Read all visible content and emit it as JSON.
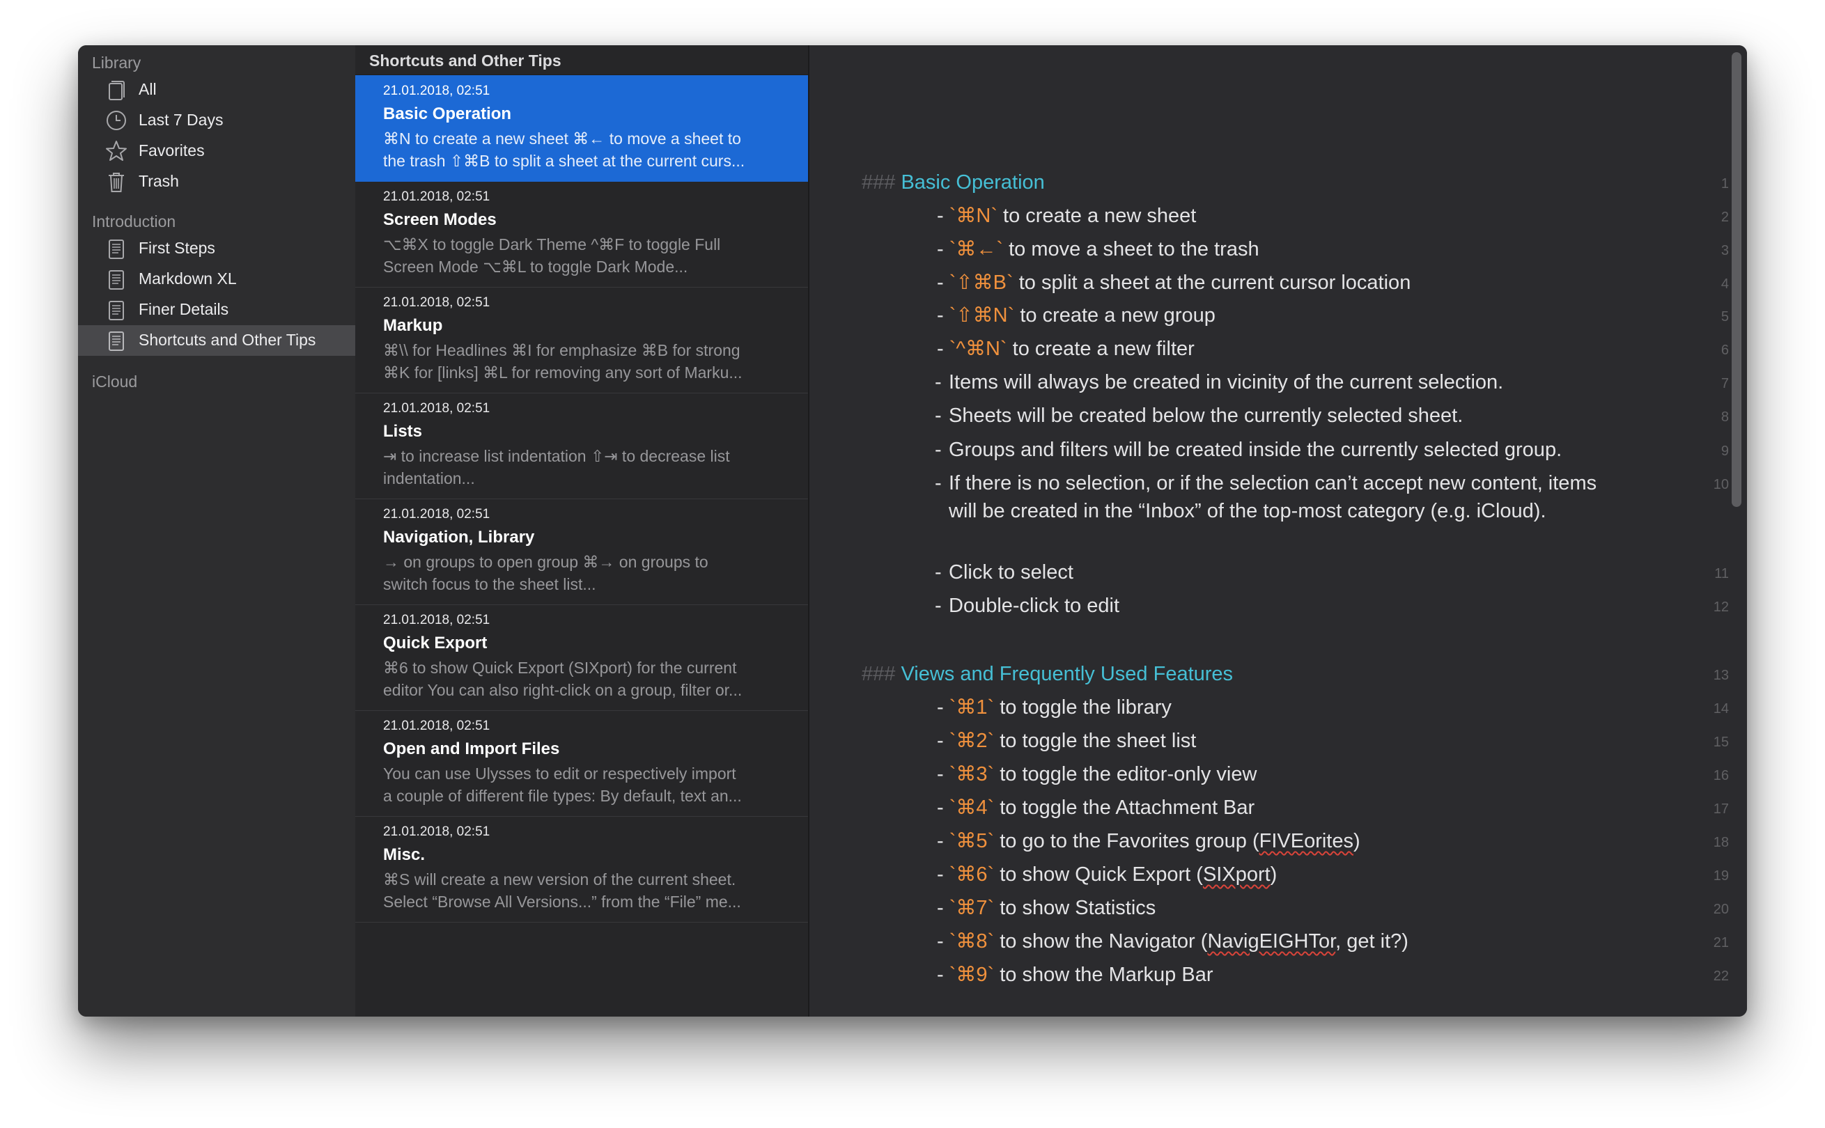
{
  "library": {
    "library_header": "Library",
    "library_items": [
      {
        "label": "All",
        "icon": "all-sheets-icon"
      },
      {
        "label": "Last 7 Days",
        "icon": "clock-icon"
      },
      {
        "label": "Favorites",
        "icon": "star-icon"
      },
      {
        "label": "Trash",
        "icon": "trash-icon"
      }
    ],
    "introduction_header": "Introduction",
    "introduction_items": [
      {
        "label": "First Steps",
        "icon": "document-icon"
      },
      {
        "label": "Markdown XL",
        "icon": "document-icon"
      },
      {
        "label": "Finer Details",
        "icon": "document-icon"
      },
      {
        "label": "Shortcuts and Other Tips",
        "icon": "document-icon",
        "selected": true
      }
    ],
    "icloud_header": "iCloud"
  },
  "sheet_list": {
    "title": "Shortcuts and Other Tips",
    "sheets": [
      {
        "date": "21.01.2018, 02:51",
        "title": "Basic Operation",
        "excerpt": "⌘N to create a new sheet ⌘← to move a sheet to\nthe trash ⇧⌘B to split a sheet at the current curs...",
        "selected": true
      },
      {
        "date": "21.01.2018, 02:51",
        "title": "Screen Modes",
        "excerpt": "⌥⌘X to toggle Dark Theme ^⌘F to toggle Full\nScreen Mode ⌥⌘L to toggle Dark Mode..."
      },
      {
        "date": "21.01.2018, 02:51",
        "title": "Markup",
        "excerpt": "⌘\\\\ for Headlines ⌘I for emphasize ⌘B for strong\n⌘K for [links] ⌘L for removing any sort of Marku..."
      },
      {
        "date": "21.01.2018, 02:51",
        "title": "Lists",
        "excerpt": "⇥ to increase list indentation ⇧⇥ to decrease list\nindentation..."
      },
      {
        "date": "21.01.2018, 02:51",
        "title": "Navigation, Library",
        "excerpt": "→ on groups to open group ⌘→ on groups to\nswitch focus to the sheet list..."
      },
      {
        "date": "21.01.2018, 02:51",
        "title": "Quick Export",
        "excerpt": "⌘6 to show Quick Export (SIXport) for the current\neditor You can also right-click on a group, filter or..."
      },
      {
        "date": "21.01.2018, 02:51",
        "title": "Open and Import Files",
        "excerpt": "You can use Ulysses to edit or respectively import\na couple of different file types: By default, text an..."
      },
      {
        "date": "21.01.2018, 02:51",
        "title": "Misc.",
        "excerpt": "⌘S will create a new version of the current sheet.\nSelect “Browse All Versions...” from the “File” me..."
      }
    ]
  },
  "editor": {
    "lines": [
      {
        "num": "1",
        "kind": "heading",
        "hashes": "###",
        "text": "Basic Operation"
      },
      {
        "num": "2",
        "kind": "shortcut",
        "code": "`⌘N`",
        "text": "to create a new sheet"
      },
      {
        "num": "3",
        "kind": "shortcut",
        "code": "`⌘←`",
        "text": "to move a sheet to the trash"
      },
      {
        "num": "4",
        "kind": "shortcut",
        "code": "`⇧⌘B`",
        "text": "to split a sheet at the current cursor location"
      },
      {
        "num": "5",
        "kind": "shortcut",
        "code": "`⇧⌘N`",
        "text": "to create a new group"
      },
      {
        "num": "6",
        "kind": "shortcut",
        "code": "`^⌘N`",
        "text": "to create a new filter"
      },
      {
        "num": "7",
        "kind": "bullet",
        "text": "Items will always be created in vicinity of the current selection."
      },
      {
        "num": "8",
        "kind": "bullet",
        "text": "Sheets will be created below the currently selected sheet."
      },
      {
        "num": "9",
        "kind": "bullet",
        "text": "Groups and filters will be created inside the currently selected group."
      },
      {
        "num": "10",
        "kind": "bullet",
        "text": "If there is no selection, or if the selection can’t accept new content, items will be created in the “Inbox” of the top-most category (e.g. iCloud)."
      },
      {
        "num": "11",
        "kind": "bullet",
        "text": "Click to select"
      },
      {
        "num": "12",
        "kind": "bullet",
        "text": "Double-click to edit"
      },
      {
        "num": "13",
        "kind": "heading",
        "hashes": "###",
        "text": "Views and Frequently Used Features"
      },
      {
        "num": "14",
        "kind": "shortcut",
        "code": "`⌘1`",
        "text": "to toggle the library"
      },
      {
        "num": "15",
        "kind": "shortcut",
        "code": "`⌘2`",
        "text": "to toggle the sheet list"
      },
      {
        "num": "16",
        "kind": "shortcut",
        "code": "`⌘3`",
        "text": "to toggle the editor-only view"
      },
      {
        "num": "17",
        "kind": "shortcut",
        "code": "`⌘4`",
        "text": "to toggle the Attachment Bar"
      },
      {
        "num": "18",
        "kind": "shortcut",
        "code": "`⌘5`",
        "text": "to go to the Favorites group (",
        "spell": "FIVEorites",
        "after": ")"
      },
      {
        "num": "19",
        "kind": "shortcut",
        "code": "`⌘6`",
        "text": "to show Quick Export (",
        "spell": "SIXport",
        "after": ")"
      },
      {
        "num": "20",
        "kind": "shortcut",
        "code": "`⌘7`",
        "text": "to show Statistics"
      },
      {
        "num": "21",
        "kind": "shortcut",
        "code": "`⌘8`",
        "text": "to show the Navigator (",
        "spell": "NavigEIGHTor",
        "after": ", get it?)"
      },
      {
        "num": "22",
        "kind": "shortcut",
        "code": "`⌘9`",
        "text": "to show the Markup Bar"
      }
    ]
  },
  "colors": {
    "window_bg": "#2a2a2c",
    "selection_blue": "#1c69d5",
    "heading_teal": "#46bfd5",
    "code_orange": "#f0913d"
  }
}
